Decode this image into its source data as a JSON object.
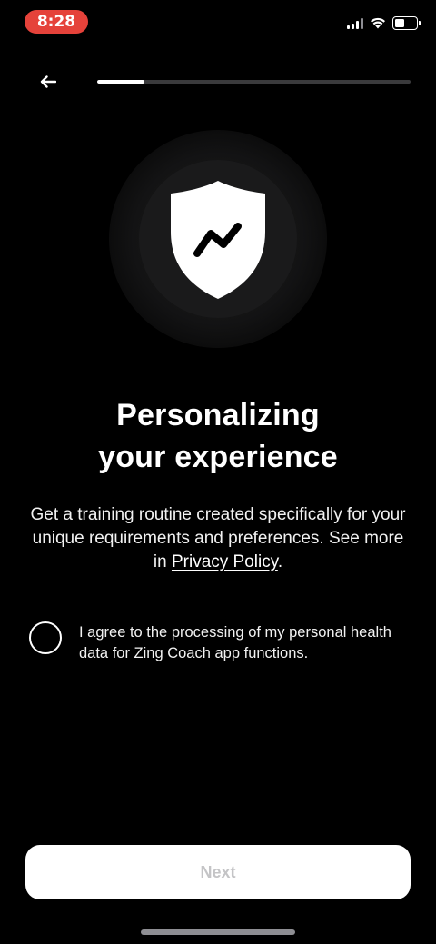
{
  "status_bar": {
    "time": "8:28",
    "time_pill_color": "#e5423a",
    "icons": [
      "cellular-signal-icon",
      "wifi-icon",
      "battery-icon"
    ],
    "battery_level": 0.45
  },
  "header": {
    "back_icon": "arrow-left-icon",
    "progress": 0.15
  },
  "hero": {
    "icon": "shield-lightning-icon"
  },
  "content": {
    "title_line1": "Personalizing",
    "title_line2": "your experience",
    "subtitle": "Get a training routine created specifically for your unique requirements and preferences. See more in ",
    "privacy_link": "Privacy Policy",
    "subtitle_end": "."
  },
  "consent": {
    "checked": false,
    "text": "I agree to the processing of my personal health data for Zing Coach app functions."
  },
  "footer": {
    "next_label": "Next"
  },
  "colors": {
    "background": "#000000",
    "button_bg": "#ffffff",
    "button_text_disabled": "#c4c4c6",
    "progress_track": "#3a3a3c"
  }
}
